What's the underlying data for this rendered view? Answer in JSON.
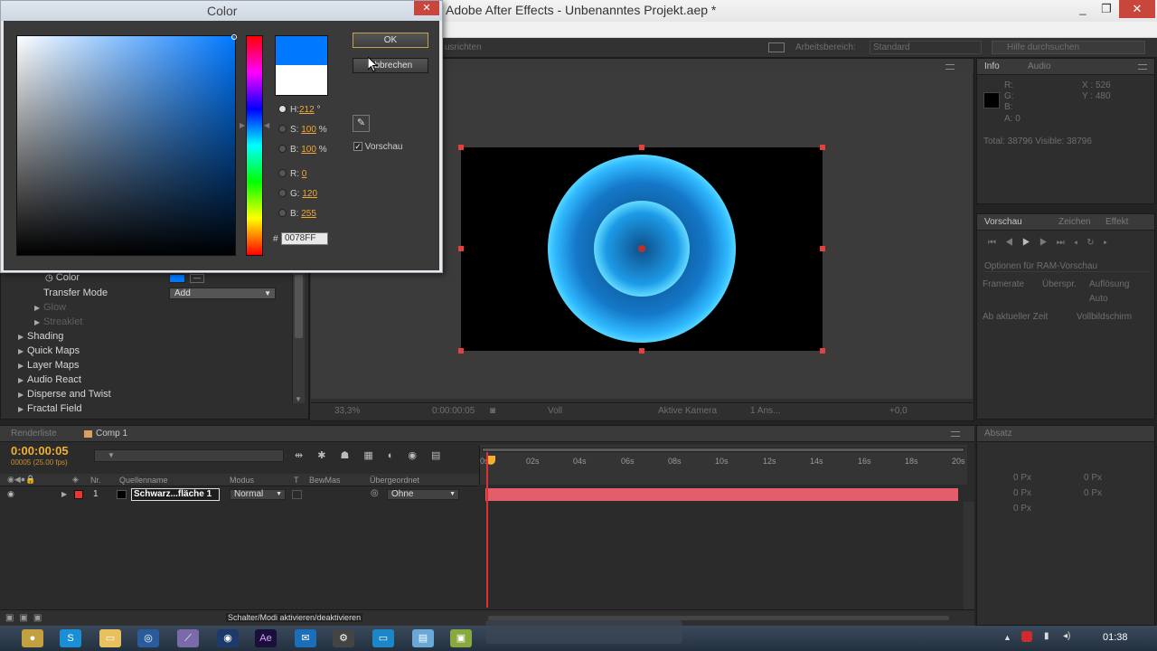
{
  "app": {
    "title": "Adobe After Effects - Unbenanntes Projekt.aep *",
    "window_controls": [
      "_",
      "❐",
      "✕"
    ]
  },
  "toolbar": {
    "workspace_label": "Arbeitsbereich:",
    "workspace_value": "Standard",
    "search_placeholder": "Hilfe durchsuchen",
    "left_fragment": "usrichten"
  },
  "color_dialog": {
    "title": "Color",
    "ok_label": "OK",
    "cancel_label": "Abbrechen",
    "fields": [
      {
        "label": "H:",
        "value": "212",
        "unit": "°",
        "selected": true
      },
      {
        "label": "S:",
        "value": "100",
        "unit": "%",
        "selected": false
      },
      {
        "label": "B:",
        "value": "100",
        "unit": "%",
        "selected": false
      },
      {
        "label": "R:",
        "value": "0",
        "unit": "",
        "selected": false
      },
      {
        "label": "G:",
        "value": "120",
        "unit": "",
        "selected": false
      },
      {
        "label": "B:",
        "value": "255",
        "unit": "",
        "selected": false
      }
    ],
    "hex_prefix": "#",
    "hex_value": "0078FF",
    "preview_label": "Vorschau",
    "preview_checked": true,
    "new_color": "#0078ff",
    "old_color": "#ffffff"
  },
  "effects": {
    "color_label": "Color",
    "transfer_mode_label": "Transfer Mode",
    "transfer_mode_value": "Add",
    "glow_label": "Glow",
    "streaklet_label": "Streaklet",
    "groups": [
      "Shading",
      "Quick Maps",
      "Layer Maps",
      "Audio React",
      "Disperse and Twist",
      "Fractal Field"
    ]
  },
  "comp_footer": {
    "zoom": "33,3%",
    "time": "0:00:00:05",
    "resolution": "Voll",
    "camera": "Aktive Kamera",
    "views": "1 Ans...",
    "exposure": "+0,0"
  },
  "info_panel": {
    "tabs": [
      "Info",
      "Audio"
    ],
    "r": "R:",
    "g": "G:",
    "b": "B:",
    "a": "A:  0",
    "x": "X : 526",
    "y": "Y : 480",
    "totals": "Total: 38796   Visible: 38796"
  },
  "preview_panel": {
    "tabs": [
      "Vorschau",
      "Zeichen",
      "Effekt"
    ],
    "ram_options": "Optionen für RAM-Vorschau",
    "framerate": "Framerate",
    "skip": "Überspr.",
    "resolution": "Auflösung",
    "res_value": "Auto",
    "from_current": "Ab aktueller Zeit",
    "fullscreen": "Vollbildschirm"
  },
  "paragraph_panel": {
    "tab": "Absatz",
    "values": [
      "0 Px",
      "0 Px",
      "0 Px",
      "0 Px",
      "0 Px"
    ]
  },
  "timeline": {
    "tabs": [
      "Renderliste",
      "Comp 1"
    ],
    "timecode": "0:00:00:05",
    "fps": "00005 (25.00 fps)",
    "columns": {
      "nr": "Nr.",
      "source": "Quellenname",
      "mode": "Modus",
      "t": "T",
      "trkmat": "BewMas",
      "parent": "Übergeordnet"
    },
    "ruler": [
      "0s",
      "02s",
      "04s",
      "06s",
      "08s",
      "10s",
      "12s",
      "14s",
      "16s",
      "18s",
      "20s"
    ],
    "layer": {
      "number": "1",
      "name": "Schwarz...fläche 1",
      "mode": "Normal",
      "parent": "Ohne"
    },
    "bottom_hint": "Schalter/Modi aktivieren/deaktivieren"
  },
  "taskbar": {
    "clock": "01:38"
  }
}
